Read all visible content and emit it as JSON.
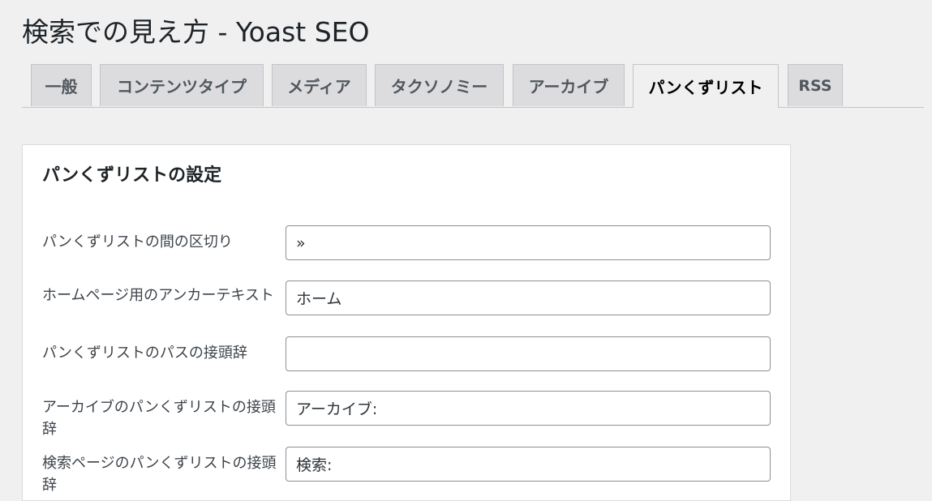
{
  "page": {
    "title": "検索での見え方 - Yoast SEO"
  },
  "tabs": [
    {
      "label": "一般",
      "active": false
    },
    {
      "label": "コンテンツタイプ",
      "active": false
    },
    {
      "label": "メディア",
      "active": false
    },
    {
      "label": "タクソノミー",
      "active": false
    },
    {
      "label": "アーカイブ",
      "active": false
    },
    {
      "label": "パンくずリスト",
      "active": true
    },
    {
      "label": "RSS",
      "active": false
    }
  ],
  "breadcrumbs_settings": {
    "heading": "パンくずリストの設定",
    "fields": [
      {
        "label": "パンくずリストの間の区切り",
        "value": "»"
      },
      {
        "label": "ホームページ用のアンカーテキスト",
        "value": "ホーム"
      },
      {
        "label": "パンくずリストのパスの接頭辞",
        "value": ""
      },
      {
        "label": "アーカイブのパンくずリストの接頭辞",
        "value": "アーカイブ:"
      },
      {
        "label": "検索ページのパンくずリストの接頭辞",
        "value": "検索:"
      }
    ]
  }
}
